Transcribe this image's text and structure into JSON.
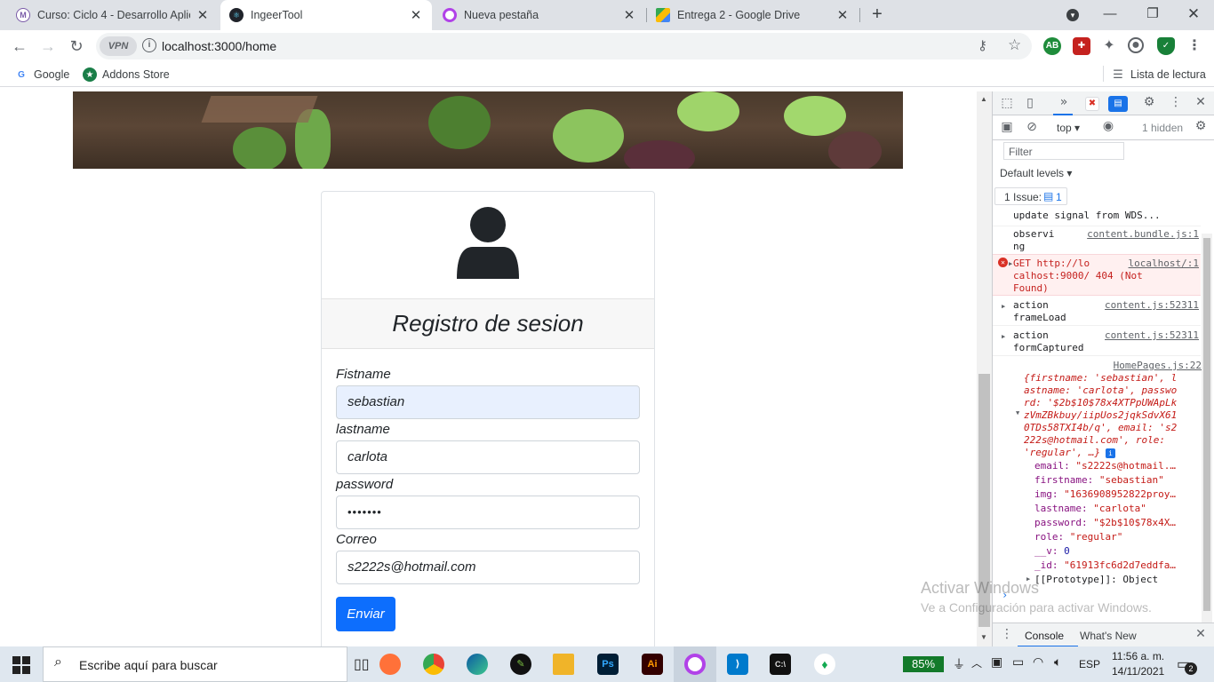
{
  "browser": {
    "tabs": [
      {
        "label": "Curso: Ciclo 4 - Desarrollo Aplica",
        "icon": "moodle-icon",
        "active": false
      },
      {
        "label": "IngeerTool",
        "icon": "react-icon",
        "active": true
      },
      {
        "label": "Nueva pestaña",
        "icon": "opera-icon",
        "active": false
      },
      {
        "label": "Entrega 2 - Google Drive",
        "icon": "drive-icon",
        "active": false
      }
    ],
    "new_tab": "+",
    "vpn_label": "VPN",
    "url": "localhost:3000/home",
    "bookmarks": [
      {
        "label": "Google",
        "icon": "google-icon"
      },
      {
        "label": "Addons Store",
        "icon": "addons-icon"
      }
    ],
    "reading_list": "Lista de lectura"
  },
  "form": {
    "title": "Registro de sesion",
    "fields": [
      {
        "label": "Fistname",
        "value": "sebastian"
      },
      {
        "label": "lastname",
        "value": "carlota"
      },
      {
        "label": "password",
        "value": "•••••••"
      },
      {
        "label": "Correo",
        "value": "s2222s@hotmail.com"
      }
    ],
    "submit": "Enviar"
  },
  "devtools": {
    "context": "top",
    "hidden": "1 hidden",
    "filter_placeholder": "Filter",
    "levels": "Default levels",
    "issues": "1 Issue:",
    "issues_count": "1",
    "logs": [
      {
        "text": "update signal from WDS...",
        "source": ""
      },
      {
        "text": "observi\nng",
        "source": "content.bundle.js:1"
      },
      {
        "text": "GET http://lo\ncalhost:9000/ 404 (Not\nFound)",
        "source": "localhost/:1",
        "type": "error"
      },
      {
        "text": "action\nframeLoad",
        "source": "content.js:52311"
      },
      {
        "text": "action\nformCaptured",
        "source": "content.js:52311"
      }
    ],
    "object_source": "HomePages.js:22",
    "object_preview": "{firstname: 'sebastian', l\nastname: 'carlota', passwo\nrd: '$2b$10$78x4XTPpUWApLk\nzVmZBkbuy/iipUos2jqkSdvX61\n0TDs58TXI4b/q', email: 's2\n222s@hotmail.com', role:\n'regular', …}",
    "object_props": [
      {
        "key": "email",
        "value": "\"s2222s@hotmail.…"
      },
      {
        "key": "firstname",
        "value": "\"sebastian\""
      },
      {
        "key": "img",
        "value": "\"1636908952822proy…"
      },
      {
        "key": "lastname",
        "value": "\"carlota\""
      },
      {
        "key": "password",
        "value": "\"$2b$10$78x4X…"
      },
      {
        "key": "role",
        "value": "\"regular\""
      },
      {
        "key": "__v",
        "value": "0"
      },
      {
        "key": "_id",
        "value": "\"61913fc6d2d7eddfa…"
      }
    ],
    "prototype": "[[Prototype]]: Object",
    "drawer_tabs": [
      "Console",
      "What's New"
    ]
  },
  "watermark": {
    "line1": "Activar Windows",
    "line2": "Ve a Configuración para activar Windows."
  },
  "taskbar": {
    "search_placeholder": "Escribe aquí para buscar",
    "battery": "85%",
    "language": "ESP",
    "time": "11:56 a. m.",
    "date": "14/11/2021",
    "notifications": "2"
  }
}
